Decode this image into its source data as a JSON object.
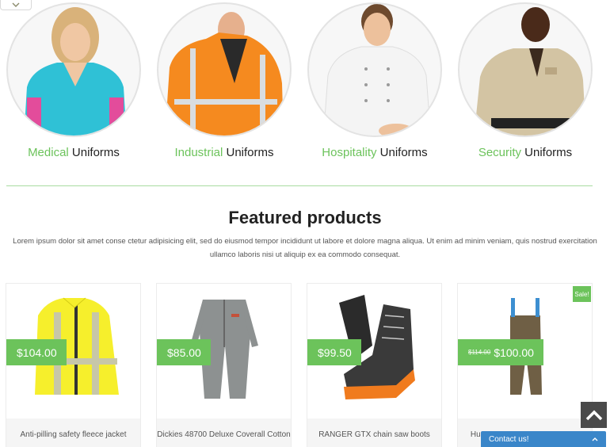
{
  "categories": [
    {
      "accent": "Medical",
      "rest": " Uniforms"
    },
    {
      "accent": "Industrial",
      "rest": " Uniforms"
    },
    {
      "accent": "Hospitality",
      "rest": " Uniforms"
    },
    {
      "accent": "Security",
      "rest": " Uniforms"
    }
  ],
  "featured": {
    "title": "Featured products",
    "description": "Lorem ipsum dolor sit amet conse ctetur adipisicing elit, sed do eiusmod tempor incididunt ut labore et dolore magna aliqua. Ut enim ad minim veniam, quis nostrud exercitation ullamco laboris nisi ut aliquip ex ea commodo consequat."
  },
  "products": [
    {
      "name": "Anti-pilling safety fleece jacket",
      "price": "$104.00",
      "old_price": ""
    },
    {
      "name": "Dickies 48700 Deluxe Coverall Cotton",
      "price": "$85.00",
      "old_price": ""
    },
    {
      "name": "RANGER GTX chain saw boots",
      "price": "$99.50",
      "old_price": ""
    },
    {
      "name": "Husqvarna Carpenter Trousers",
      "price": "$100.00",
      "old_price": "$114.00",
      "badge": "Sale!"
    }
  ],
  "contact": {
    "label": "Contact us!"
  },
  "colors": {
    "accent": "#6cc35b",
    "contact": "#3a86c9",
    "scroll_top": "#4a4a4a"
  }
}
